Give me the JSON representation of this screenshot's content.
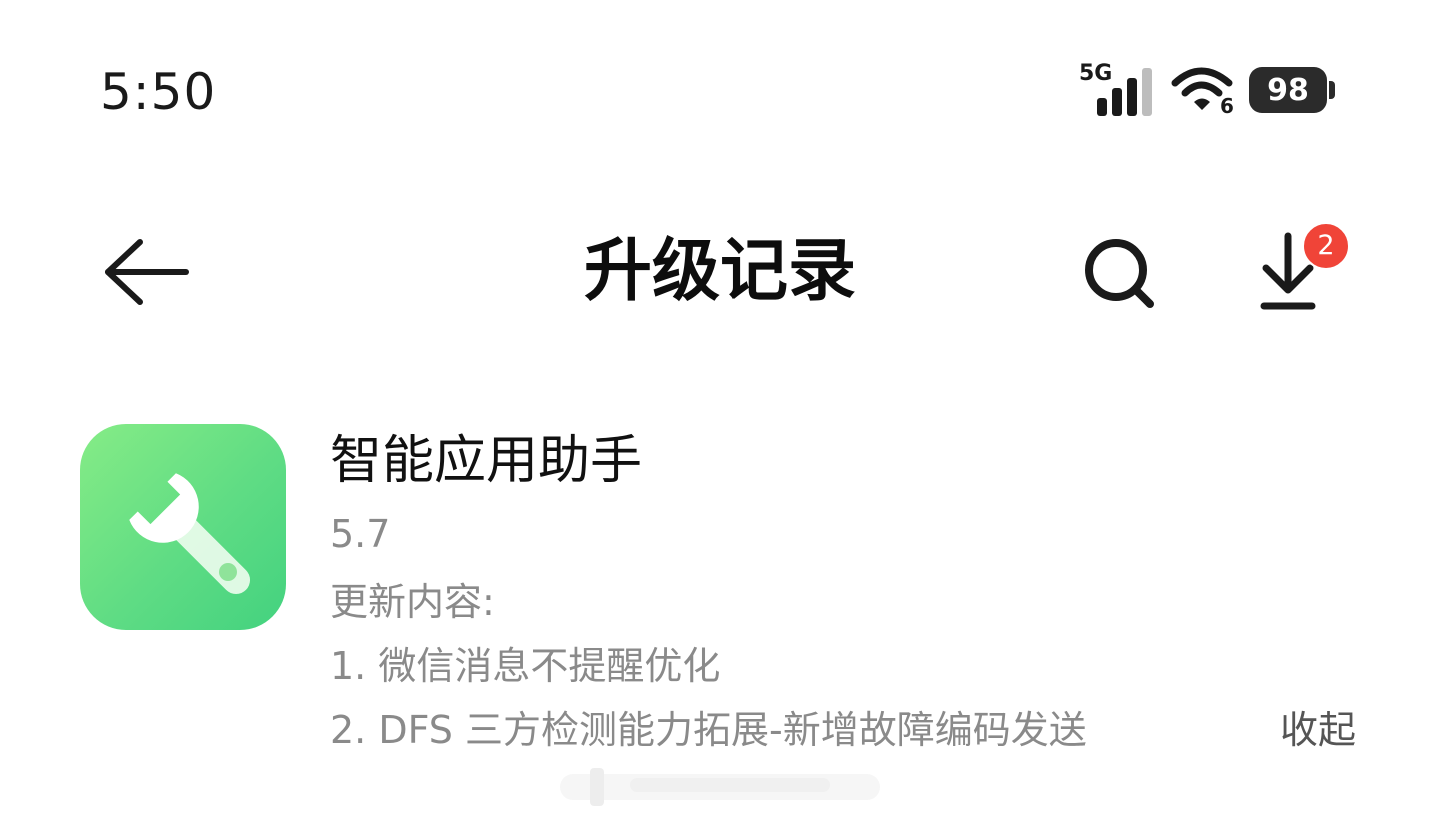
{
  "status_bar": {
    "time": "5:50",
    "network_label": "5G",
    "wifi_label": "6",
    "battery_level": "98",
    "icons": [
      "cellular-signal-icon",
      "wifi-icon",
      "battery-icon"
    ]
  },
  "toolbar": {
    "title": "升级记录",
    "back_icon": "arrow-left-icon",
    "search_icon": "search-icon",
    "download_icon": "download-icon",
    "download_badge": "2"
  },
  "record": {
    "app_name": "智能应用助手",
    "version": "5.7",
    "notes_heading": "更新内容:",
    "notes": [
      "1. 微信消息不提醒优化",
      "2. DFS 三方检测能力拓展-新增故障编码发送"
    ],
    "collapse_label": "收起",
    "icon": "wrench-icon"
  },
  "colors": {
    "accent_green": "#5fdc84",
    "badge_red": "#f04438",
    "muted_text": "#8a8a8a"
  }
}
